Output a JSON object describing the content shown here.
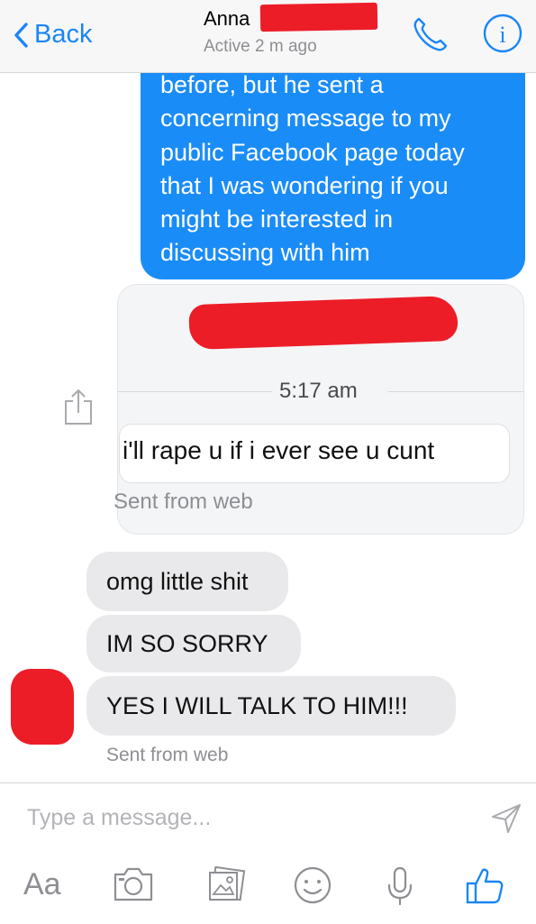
{
  "header": {
    "back_label": "Back",
    "contact_name": "Anna",
    "status": "Active 2 m ago"
  },
  "conversation": {
    "outgoing_lines": [
      "before, but he sent a",
      "concerning message to my",
      "public Facebook page today",
      "that I was wondering if you",
      "might be interested in",
      "discussing with him"
    ],
    "shared_message": {
      "time": "5:17 am",
      "text": "i'll rape u if i ever see u cunt",
      "sent_from": "Sent from web"
    },
    "incoming": [
      "omg little shit",
      "IM SO SORRY",
      "YES I WILL TALK TO HIM!!!"
    ],
    "sent_from": "Sent from web"
  },
  "composer": {
    "placeholder": "Type a message...",
    "text_format_label": "Aa"
  },
  "colors": {
    "accent": "#1b86f8",
    "outgoing_bubble": "#1a8cf8",
    "incoming_bubble": "#e9e9eb",
    "redaction": "#ec1d27"
  },
  "icons": [
    "chevron-left-icon",
    "phone-icon",
    "info-icon",
    "share-icon",
    "send-icon",
    "camera-icon",
    "photo-icon",
    "emoji-icon",
    "microphone-icon",
    "thumbs-up-icon"
  ]
}
